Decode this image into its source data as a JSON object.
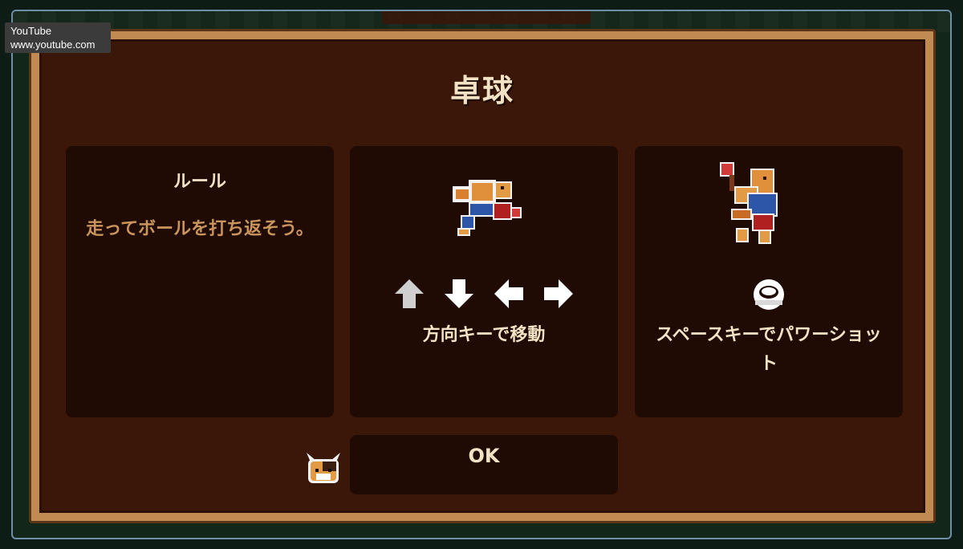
{
  "tooltip": {
    "title": "YouTube",
    "url": "www.youtube.com"
  },
  "dialog": {
    "title": "卓球",
    "rule_panel": {
      "heading": "ルール",
      "description": "走ってボールを打ち返そう。"
    },
    "move_panel": {
      "keys": [
        "arrow-up-icon",
        "arrow-down-icon",
        "arrow-left-icon",
        "arrow-right-icon"
      ],
      "caption": "方向キーで移動"
    },
    "shot_panel": {
      "key": "spacebar-icon",
      "caption": "スペースキーでパワーショット"
    },
    "ok_label": "OK"
  },
  "colors": {
    "panel_bg": "#1f0b04",
    "dialog_bg": "#3a1708",
    "frame": "#c08a52",
    "text_light": "#f3e2c3",
    "text_tan": "#c9955d"
  }
}
